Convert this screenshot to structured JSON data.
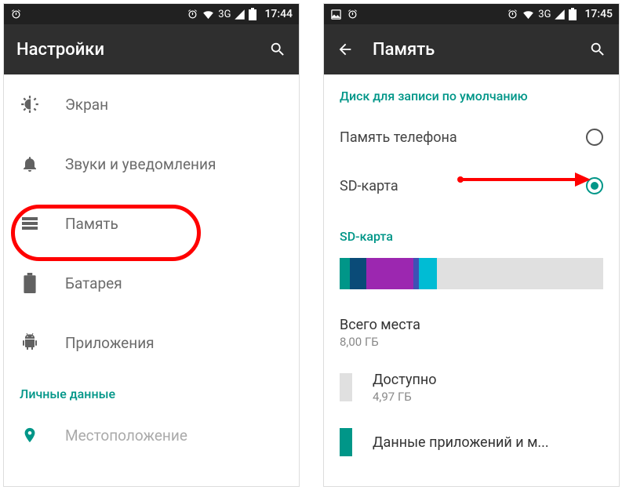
{
  "left": {
    "status": {
      "time": "17:44",
      "net": "3G"
    },
    "appbar": {
      "title": "Настройки"
    },
    "items": [
      {
        "label": "Экран"
      },
      {
        "label": "Звуки и уведомления"
      },
      {
        "label": "Память"
      },
      {
        "label": "Батарея"
      },
      {
        "label": "Приложения"
      }
    ],
    "section": "Личные данные",
    "items2": [
      {
        "label": "Местоположение"
      }
    ]
  },
  "right": {
    "status": {
      "time": "17:45",
      "net": "3G"
    },
    "appbar": {
      "title": "Память"
    },
    "default_disk_header": "Диск для записи по умолчанию",
    "radios": [
      {
        "label": "Память телефона"
      },
      {
        "label": "SD-карта"
      }
    ],
    "sd_header": "SD-карта",
    "total": {
      "label": "Всего места",
      "value": "8,00 ГБ"
    },
    "available": {
      "label": "Доступно",
      "value": "4,97 ГБ"
    },
    "apps": {
      "label": "Данные приложений и м..."
    },
    "segments": [
      {
        "color": "#009688",
        "width": "4%"
      },
      {
        "color": "#0a4b78",
        "width": "6%"
      },
      {
        "color": "#9c27b0",
        "width": "18%"
      },
      {
        "color": "#3f51b5",
        "width": "2%"
      },
      {
        "color": "#00bcd4",
        "width": "7%"
      }
    ]
  }
}
